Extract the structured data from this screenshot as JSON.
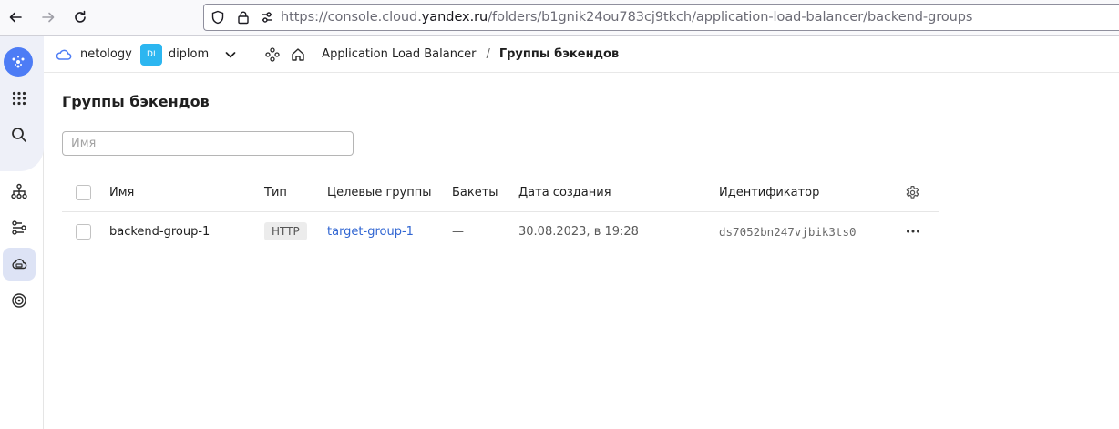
{
  "browser": {
    "url_prefix": "https://console.cloud.",
    "url_host": "yandex.ru",
    "url_path": "/folders/b1gnik24ou783cj9tkch/application-load-balancer/backend-groups"
  },
  "header": {
    "cloud_name": "netology",
    "folder_badge": "DI",
    "folder_name": "diplom",
    "service_name": "Application Load Balancer",
    "separator": "/",
    "current_page": "Группы бэкендов"
  },
  "main": {
    "title": "Группы бэкендов",
    "search_placeholder": "Имя",
    "search_value": ""
  },
  "table": {
    "columns": [
      "Имя",
      "Тип",
      "Целевые группы",
      "Бакеты",
      "Дата создания",
      "Идентификатор"
    ],
    "rows": [
      {
        "name": "backend-group-1",
        "type": "HTTP",
        "target_groups": "target-group-1",
        "buckets": "—",
        "created": "30.08.2023, в 19:28",
        "id": "ds7052bn247vjbik3ts0"
      }
    ]
  },
  "colors": {
    "accent": "#4d7cf5",
    "link": "#3166d2",
    "folder_badge": "#2cb6f0",
    "sidebar_active": "#dde3f5"
  },
  "icons": {
    "back": "arrow-left-icon",
    "forward": "arrow-right-icon",
    "reload": "reload-icon",
    "shield": "shield-icon",
    "lock": "lock-icon",
    "permissions": "permissions-icon",
    "logo": "yandex-cloud-logo-icon",
    "services": "grid-dots-icon",
    "search": "search-icon",
    "hierarchy": "hierarchy-icon",
    "routes": "routes-icon",
    "load_balancer": "load-balancer-icon",
    "target": "target-icon",
    "cloud": "cloud-icon",
    "chevron": "chevron-down-icon",
    "nodes": "nodes-icon",
    "home": "home-icon",
    "gear": "gear-icon",
    "more": "more-icon"
  }
}
